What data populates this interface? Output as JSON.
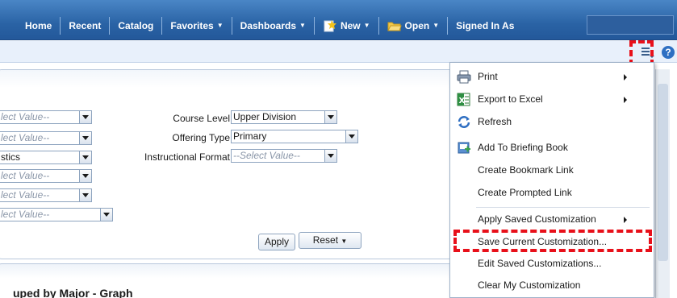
{
  "nav": {
    "items": [
      {
        "label": "Home"
      },
      {
        "label": "Recent"
      },
      {
        "label": "Catalog"
      },
      {
        "label": "Favorites",
        "dropdown": true
      },
      {
        "label": "Dashboards",
        "dropdown": true
      },
      {
        "label": "New",
        "dropdown": true,
        "icon": "new-document-icon"
      },
      {
        "label": "Open",
        "dropdown": true,
        "icon": "folder-icon"
      },
      {
        "label": "Signed In As"
      }
    ]
  },
  "prompts": {
    "left_column": [
      {
        "value": "lect Value--",
        "placeholder": true
      },
      {
        "value": "lect Value--",
        "placeholder": true
      },
      {
        "value": "stics",
        "placeholder": false
      },
      {
        "value": "lect Value--",
        "placeholder": true
      },
      {
        "value": "lect Value--",
        "placeholder": true
      },
      {
        "value": "lect Value--",
        "placeholder": true
      }
    ],
    "course_level": {
      "label": "Course Level",
      "value": "Upper Division"
    },
    "offering_type": {
      "label": "Offering Type",
      "value": "Primary"
    },
    "instructional_format": {
      "label": "Instructional Format",
      "value": "--Select Value--"
    },
    "apply_label": "Apply",
    "reset_label": "Reset"
  },
  "section_title": "uped by Major - Graph",
  "menu": {
    "items": [
      {
        "label": "Print",
        "submenu": true,
        "icon": "printer-icon"
      },
      {
        "label": "Export to Excel",
        "submenu": true,
        "icon": "excel-icon"
      },
      {
        "label": "Refresh",
        "submenu": false,
        "icon": "refresh-icon"
      },
      {
        "label": "Add To Briefing Book",
        "submenu": false,
        "icon": "briefing-book-icon"
      },
      {
        "label": "Create Bookmark Link",
        "submenu": false
      },
      {
        "label": "Create Prompted Link",
        "submenu": false
      },
      {
        "label": "Apply Saved Customization",
        "submenu": true
      },
      {
        "label": "Save Current Customization...",
        "submenu": false
      },
      {
        "label": "Edit Saved Customizations...",
        "submenu": false
      },
      {
        "label": "Clear My Customization",
        "submenu": false
      }
    ]
  },
  "colors": {
    "nav_bg": "#2a63a5",
    "highlight": "#e8101a",
    "help": "#2e6fc2"
  }
}
